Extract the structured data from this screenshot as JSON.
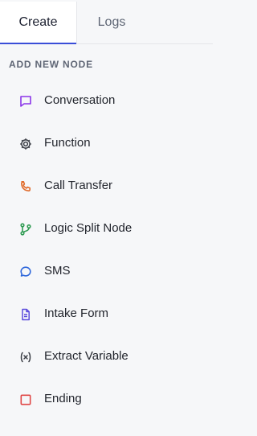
{
  "tabs": {
    "create": "Create",
    "logs": "Logs"
  },
  "section": {
    "title": "ADD NEW NODE"
  },
  "nodes": [
    {
      "label": "Conversation",
      "icon": "chat-bubble-icon",
      "color": "#8b35e8"
    },
    {
      "label": "Function",
      "icon": "gear-icon",
      "color": "#3a3d45"
    },
    {
      "label": "Call Transfer",
      "icon": "phone-icon",
      "color": "#e06a2a"
    },
    {
      "label": "Logic Split Node",
      "icon": "branch-icon",
      "color": "#2f9b52"
    },
    {
      "label": "SMS",
      "icon": "message-circle-icon",
      "color": "#2f68db"
    },
    {
      "label": "Intake Form",
      "icon": "document-icon",
      "color": "#5b4bdc"
    },
    {
      "label": "Extract Variable",
      "icon": "variable-icon",
      "color": "#3a3d45"
    },
    {
      "label": "Ending",
      "icon": "stop-square-icon",
      "color": "#e04848"
    }
  ]
}
